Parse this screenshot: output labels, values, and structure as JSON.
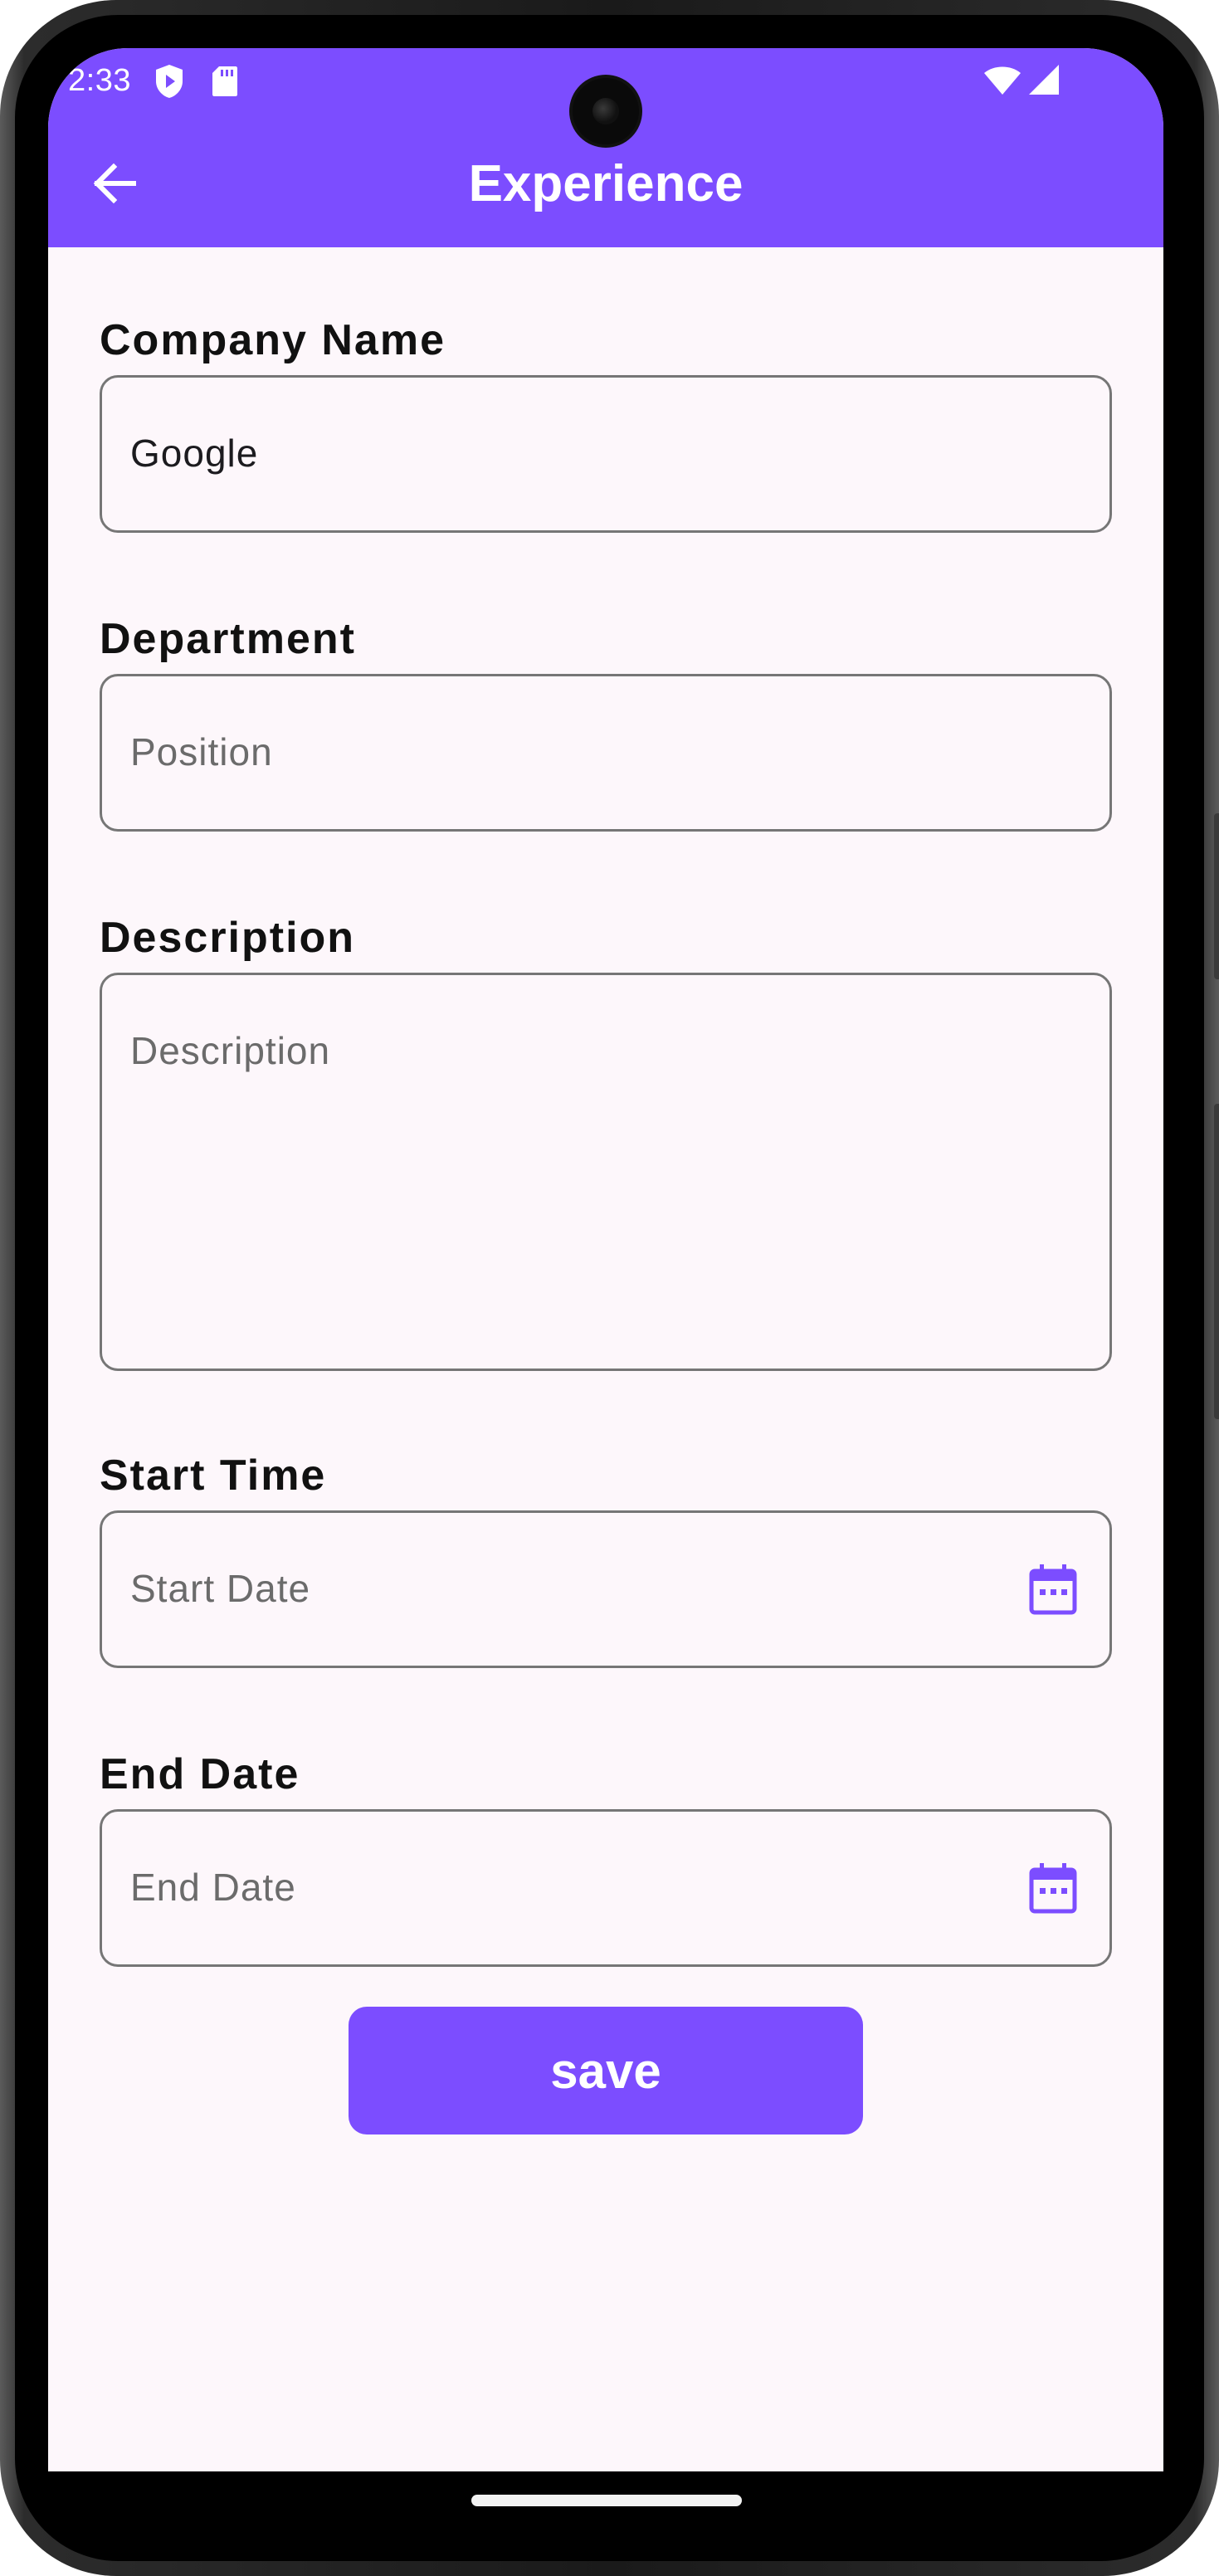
{
  "status_bar": {
    "time": "2:33",
    "icons": [
      "shield-play-icon",
      "sd-card-icon",
      "wifi-icon",
      "cell-signal-icon"
    ]
  },
  "app_bar": {
    "title": "Experience",
    "back_icon": "arrow-back-icon",
    "color": "#7c4dff"
  },
  "form": {
    "company": {
      "label": "Company Name",
      "value": "Google"
    },
    "department": {
      "label": "Department",
      "placeholder": "Position"
    },
    "description": {
      "label": "Description",
      "placeholder": "Description"
    },
    "start": {
      "label": "Start Time",
      "placeholder": "Start Date",
      "icon": "calendar-icon"
    },
    "end": {
      "label": "End Date",
      "placeholder": "End Date",
      "icon": "calendar-icon"
    }
  },
  "actions": {
    "save_label": "save"
  },
  "colors": {
    "accent": "#7c4dff",
    "background": "#fdf7fb",
    "border": "#767676"
  }
}
